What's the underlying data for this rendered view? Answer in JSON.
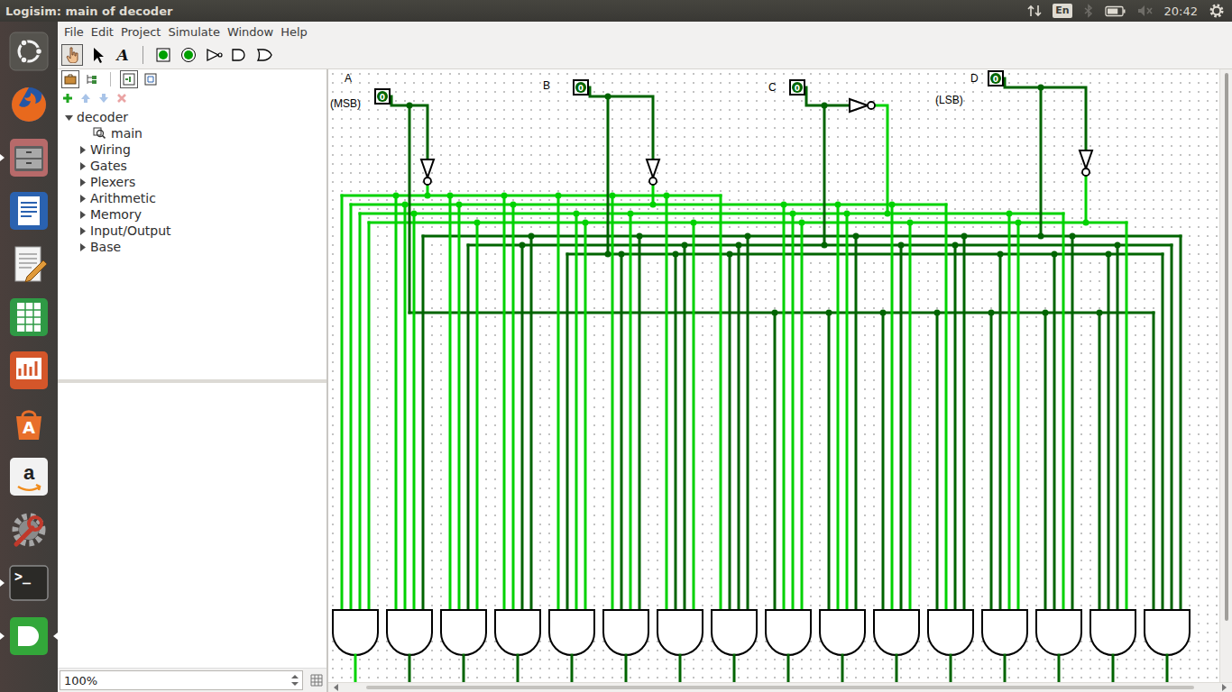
{
  "top_panel": {
    "title": "Logisim: main of decoder",
    "keyboard_layout": "En",
    "time": "20:42",
    "bluetooth_enabled": false,
    "volume_muted": true,
    "battery_level": 0.75
  },
  "launcher": [
    {
      "kind": "dash",
      "running": false,
      "focused": false
    },
    {
      "kind": "firefox",
      "running": false,
      "focused": false
    },
    {
      "kind": "files",
      "running": true,
      "focused": false
    },
    {
      "kind": "writer",
      "running": false,
      "focused": false
    },
    {
      "kind": "text-editor",
      "running": false,
      "focused": false
    },
    {
      "kind": "calc",
      "running": false,
      "focused": false
    },
    {
      "kind": "impress",
      "running": false,
      "focused": false
    },
    {
      "kind": "software-center",
      "glyph": "A",
      "running": false,
      "focused": false
    },
    {
      "kind": "amazon",
      "glyph": "a",
      "running": false,
      "focused": false
    },
    {
      "kind": "settings",
      "running": false,
      "focused": false
    },
    {
      "kind": "terminal",
      "glyph": ">_",
      "running": true,
      "focused": false
    },
    {
      "kind": "logisim",
      "running": true,
      "focused": true
    }
  ],
  "menu": [
    "File",
    "Edit",
    "Project",
    "Simulate",
    "Window",
    "Help"
  ],
  "tools": [
    {
      "kind": "poke",
      "selected": true
    },
    {
      "kind": "select",
      "selected": false
    },
    {
      "kind": "text",
      "glyph": "A",
      "selected": false
    },
    {
      "kind": "input-pin",
      "selected": false
    },
    {
      "kind": "output-pin",
      "selected": false
    },
    {
      "kind": "not-gate",
      "selected": false
    },
    {
      "kind": "and-gate",
      "selected": false
    },
    {
      "kind": "or-gate",
      "selected": false
    }
  ],
  "explorer_tools": [
    {
      "kind": "toolbox",
      "selected": true
    },
    {
      "kind": "simulation-tree",
      "selected": false
    },
    {
      "kind": "edit-layout",
      "selected": true
    },
    {
      "kind": "edit-appearance",
      "selected": false
    }
  ],
  "project_buttons": [
    {
      "kind": "add",
      "disabled": false
    },
    {
      "kind": "move-up",
      "disabled": true
    },
    {
      "kind": "move-down",
      "disabled": true
    },
    {
      "kind": "remove",
      "disabled": true
    }
  ],
  "tree": [
    {
      "label": "decoder",
      "level": 0,
      "kind": "project",
      "expanded": true
    },
    {
      "label": "main",
      "level": 1,
      "kind": "circuit"
    },
    {
      "label": "Wiring",
      "level": 1,
      "kind": "library",
      "expanded": false
    },
    {
      "label": "Gates",
      "level": 1,
      "kind": "library",
      "expanded": false
    },
    {
      "label": "Plexers",
      "level": 1,
      "kind": "library",
      "expanded": false
    },
    {
      "label": "Arithmetic",
      "level": 1,
      "kind": "library",
      "expanded": false
    },
    {
      "label": "Memory",
      "level": 1,
      "kind": "library",
      "expanded": false
    },
    {
      "label": "Input/Output",
      "level": 1,
      "kind": "library",
      "expanded": false
    },
    {
      "label": "Base",
      "level": 1,
      "kind": "library",
      "expanded": false
    }
  ],
  "zoom": "100%",
  "scrollbars": {
    "vertical_level": 0.9,
    "horizontal_level": 0.95
  },
  "circuit": {
    "inputs": [
      {
        "label": "A",
        "value": "0",
        "note": "(MSB)"
      },
      {
        "label": "B",
        "value": "0",
        "note": ""
      },
      {
        "label": "C",
        "value": "0",
        "note": ""
      },
      {
        "label": "D",
        "value": "0",
        "note": "(LSB)"
      }
    ],
    "gates": [
      {
        "inputs": [
          true,
          true,
          true,
          true
        ],
        "output": true
      },
      {
        "inputs": [
          true,
          true,
          true,
          false
        ],
        "output": false
      },
      {
        "inputs": [
          true,
          true,
          false,
          true
        ],
        "output": false
      },
      {
        "inputs": [
          true,
          true,
          false,
          false
        ],
        "output": false
      },
      {
        "inputs": [
          true,
          false,
          true,
          true
        ],
        "output": false
      },
      {
        "inputs": [
          true,
          false,
          true,
          false
        ],
        "output": false
      },
      {
        "inputs": [
          true,
          false,
          false,
          true
        ],
        "output": false
      },
      {
        "inputs": [
          true,
          false,
          false,
          false
        ],
        "output": false
      },
      {
        "inputs": [
          false,
          true,
          true,
          true
        ],
        "output": false
      },
      {
        "inputs": [
          false,
          true,
          true,
          false
        ],
        "output": false
      },
      {
        "inputs": [
          false,
          true,
          false,
          true
        ],
        "output": false
      },
      {
        "inputs": [
          false,
          true,
          false,
          false
        ],
        "output": false
      },
      {
        "inputs": [
          false,
          false,
          true,
          true
        ],
        "output": false
      },
      {
        "inputs": [
          false,
          false,
          true,
          false
        ],
        "output": false
      },
      {
        "inputs": [
          false,
          false,
          false,
          true
        ],
        "output": false
      },
      {
        "inputs": [
          false,
          false,
          false,
          false
        ],
        "output": false
      }
    ]
  }
}
